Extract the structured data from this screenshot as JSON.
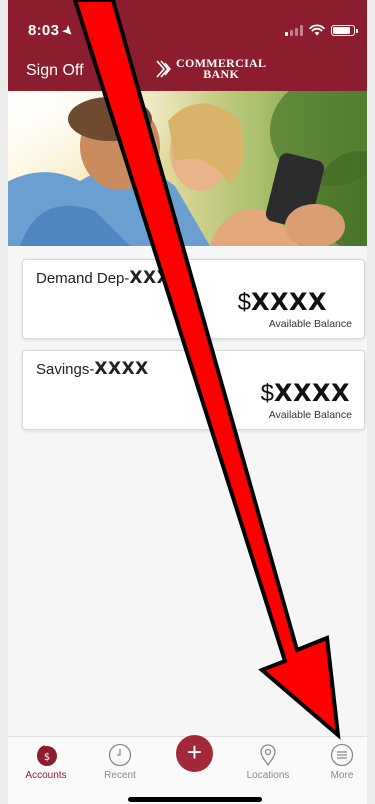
{
  "status_bar": {
    "time": "8:03"
  },
  "header": {
    "sign_off_label": "Sign Off",
    "logo_line1": "COMMERCIAL",
    "logo_line2": "BANK",
    "brand_color": "#8c1d2e"
  },
  "accounts": [
    {
      "name_prefix": "Demand Dep-",
      "name_masked": "XXXX",
      "amount_prefix": "$",
      "amount_masked": "XXXX",
      "balance_label": "Available Balance"
    },
    {
      "name_prefix": "Savings-",
      "name_masked": "XXXX",
      "amount_prefix": "$",
      "amount_masked": "XXXX",
      "balance_label": "Available Balance"
    }
  ],
  "tabbar": {
    "accounts_label": "Accounts",
    "recent_label": "Recent",
    "add_label": "+",
    "locations_label": "Locations",
    "more_label": "More",
    "accounts_badge": "$"
  },
  "overlay": {
    "arrow_color": "#ff0000",
    "arrow_icon": "red-arrow-icon"
  }
}
